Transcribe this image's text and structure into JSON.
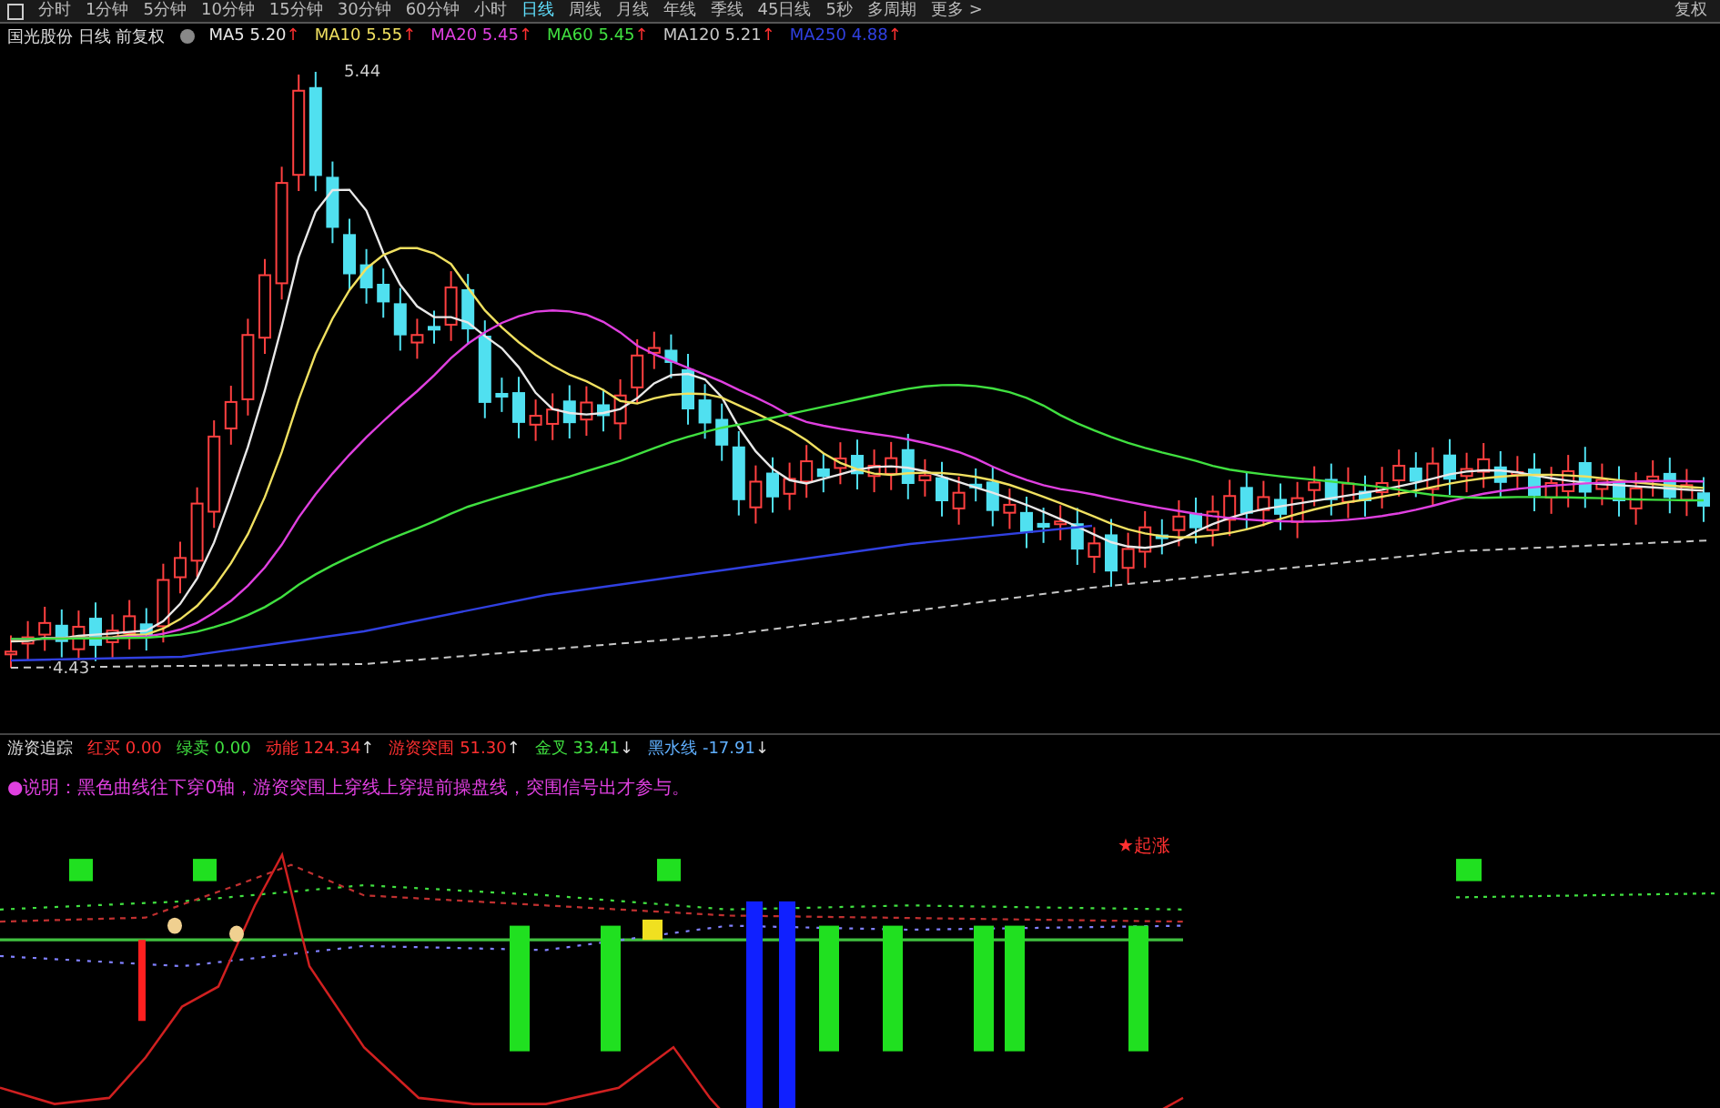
{
  "toolbar": {
    "tabs": [
      {
        "label": "分时",
        "selected": false
      },
      {
        "label": "1分钟",
        "selected": false
      },
      {
        "label": "5分钟",
        "selected": false
      },
      {
        "label": "10分钟",
        "selected": false
      },
      {
        "label": "15分钟",
        "selected": false
      },
      {
        "label": "30分钟",
        "selected": false
      },
      {
        "label": "60分钟",
        "selected": false
      },
      {
        "label": "小时",
        "selected": false
      },
      {
        "label": "日线",
        "selected": true
      },
      {
        "label": "周线",
        "selected": false
      },
      {
        "label": "月线",
        "selected": false
      },
      {
        "label": "年线",
        "selected": false
      },
      {
        "label": "季线",
        "selected": false
      },
      {
        "label": "45日线",
        "selected": false
      },
      {
        "label": "5秒",
        "selected": false
      },
      {
        "label": "多周期",
        "selected": false
      },
      {
        "label": "更多 >",
        "selected": false
      }
    ],
    "right_button": "复权"
  },
  "chart": {
    "title": "国光股份 日线 前复权",
    "mas": [
      {
        "name": "MA5",
        "value": "5.20",
        "arrow": "↑",
        "color": "#e8e8e8"
      },
      {
        "name": "MA10",
        "value": "5.55",
        "arrow": "↑",
        "color": "#f0e060"
      },
      {
        "name": "MA20",
        "value": "5.45",
        "arrow": "↑",
        "color": "#e040e0"
      },
      {
        "name": "MA60",
        "value": "5.45",
        "arrow": "↑",
        "color": "#40e040"
      },
      {
        "name": "MA120",
        "value": "5.21",
        "arrow": "↑",
        "color": "#c8c8c8"
      },
      {
        "name": "MA250",
        "value": "4.88",
        "arrow": "↑",
        "color": "#3040e0"
      }
    ],
    "high_label": "5.44",
    "low_label": "4.43"
  },
  "indicator": {
    "name": "游资追踪",
    "items": [
      {
        "name": "红买",
        "value": "0.00",
        "color": "#ff3030"
      },
      {
        "name": "绿卖",
        "value": "0.00",
        "color": "#40e040"
      },
      {
        "name": "动能",
        "value": "124.34",
        "arrow": "↑",
        "color": "#ff3030"
      },
      {
        "name": "游资突围",
        "value": "51.30",
        "arrow": "↑",
        "color": "#ff3030"
      },
      {
        "name": "金叉",
        "value": "33.41",
        "arrow": "↓",
        "color": "#40e040"
      },
      {
        "name": "黑水线",
        "value": "-17.91",
        "arrow": "↓",
        "color": "#60b0ff"
      }
    ],
    "note": "●说明：黑色曲线往下穿0轴，游资突围上穿线上穿提前操盘线，突围信号出才参与。",
    "signal": "★起涨"
  }
}
